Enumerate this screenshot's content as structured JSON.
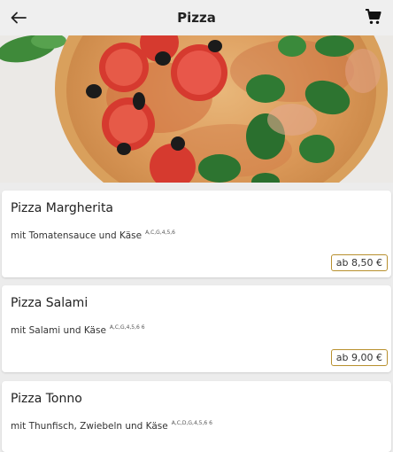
{
  "header": {
    "title": "Pizza"
  },
  "icons": {
    "back": "arrow-left-icon",
    "cart": "shopping-cart-icon"
  },
  "colors": {
    "price_border": "#b8902e",
    "header_bg": "#efefef",
    "page_bg": "#ececec"
  },
  "items": [
    {
      "name": "Pizza Margherita",
      "description": "mit Tomatensauce und Käse",
      "allergens": "A,C,G,4,5,6",
      "price": "ab 8,50 €"
    },
    {
      "name": "Pizza Salami",
      "description": "mit Salami und Käse",
      "allergens": "A,C,G,4,5,6 6",
      "price": "ab 9,00 €"
    },
    {
      "name": "Pizza Tonno",
      "description": "mit Thunfisch, Zwiebeln und Käse",
      "allergens": "A,C,D,G,4,5,6 6"
    }
  ]
}
